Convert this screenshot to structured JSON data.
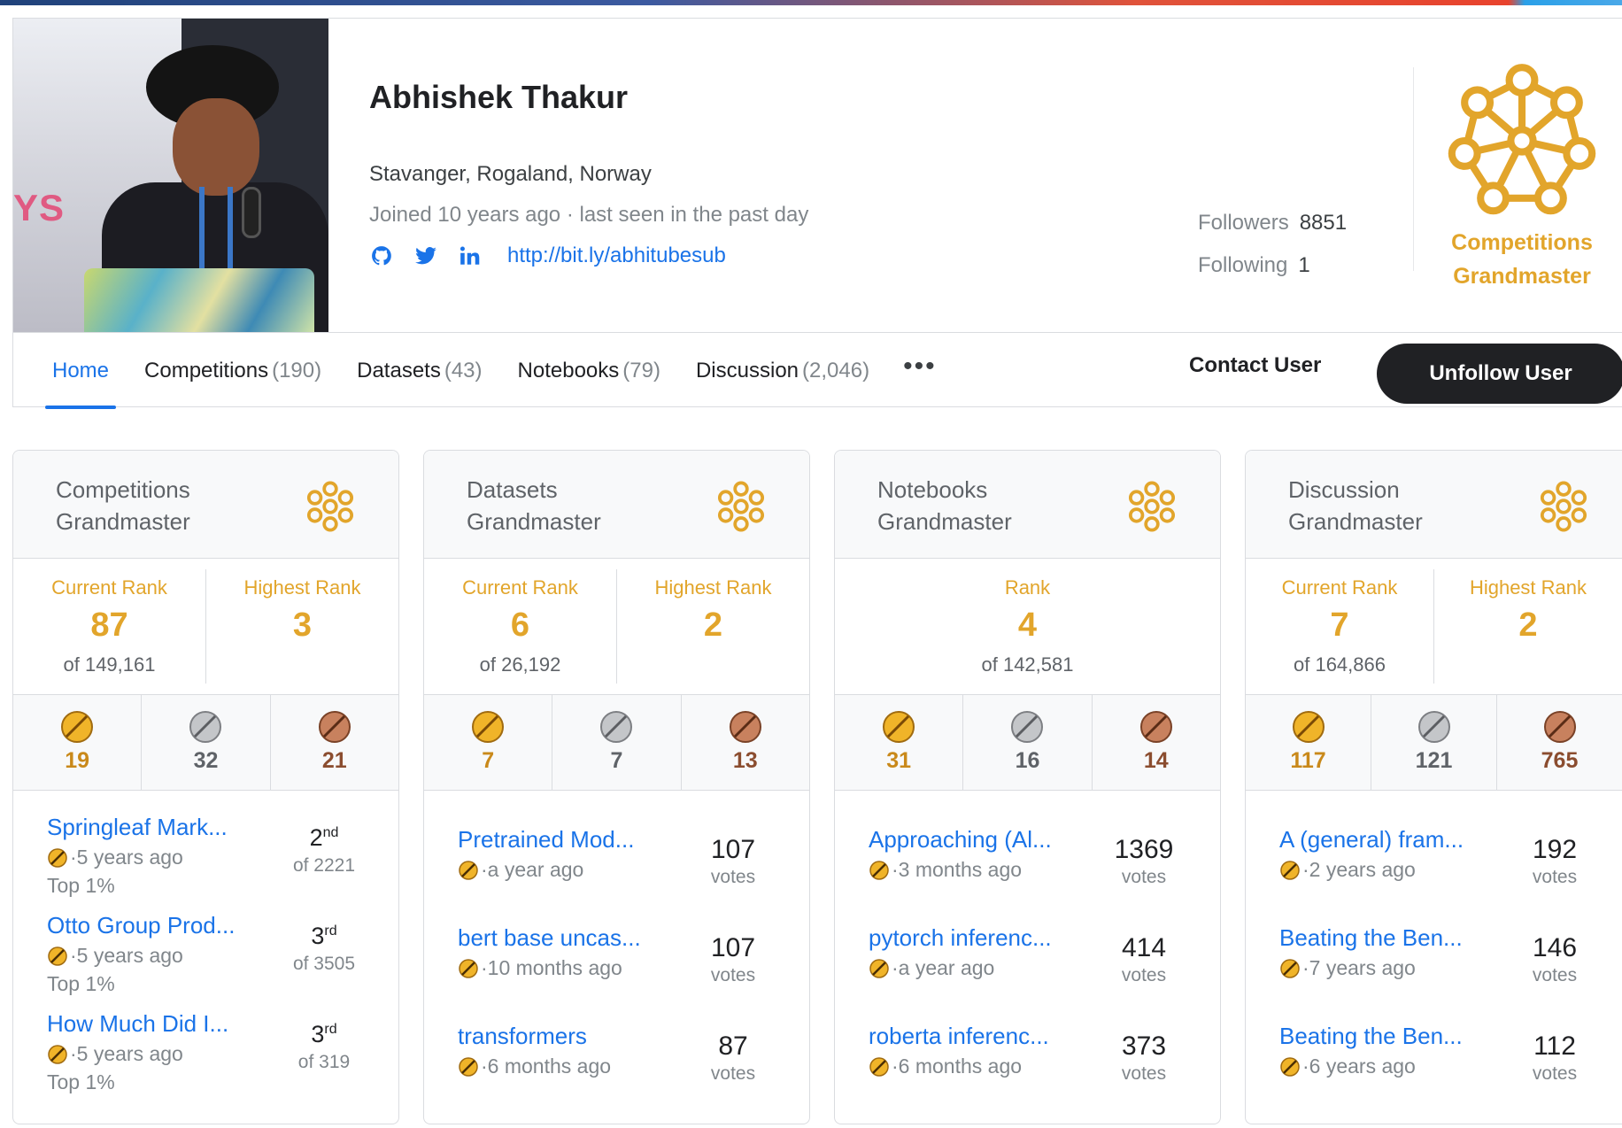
{
  "profile": {
    "name": "Abhishek Thakur",
    "location": "Stavanger, Rogaland, Norway",
    "joined": "Joined 10 years ago · last seen in the past day",
    "link": "http://bit.ly/abhitubesub",
    "followers_label": "Followers",
    "followers": "8851",
    "following_label": "Following",
    "following": "1",
    "tier_line1": "Competitions",
    "tier_line2": "Grandmaster",
    "tier_color": "#e2a52b"
  },
  "nav": {
    "tabs": [
      {
        "label": "Home",
        "count": ""
      },
      {
        "label": "Competitions",
        "count": "(190)"
      },
      {
        "label": "Datasets",
        "count": "(43)"
      },
      {
        "label": "Notebooks",
        "count": "(79)"
      },
      {
        "label": "Discussion",
        "count": "(2,046)"
      }
    ],
    "more": "•••",
    "contact": "Contact User",
    "unfollow": "Unfollow User"
  },
  "cards": [
    {
      "title1": "Competitions",
      "title2": "Grandmaster",
      "rank_label": "Current Rank",
      "rank": "87",
      "rank_of": "of 149,161",
      "high_label": "Highest Rank",
      "high": "3",
      "gold": "19",
      "silver": "32",
      "bronze": "21",
      "items": [
        {
          "title": "Springleaf Mark...",
          "age": "·5 years ago",
          "top": "Top 1%",
          "place": "2",
          "suffix": "nd",
          "of": "of 2221"
        },
        {
          "title": "Otto Group Prod...",
          "age": "·5 years ago",
          "top": "Top 1%",
          "place": "3",
          "suffix": "rd",
          "of": "of 3505"
        },
        {
          "title": "How Much Did I...",
          "age": "·5 years ago",
          "top": "Top 1%",
          "place": "3",
          "suffix": "rd",
          "of": "of 319"
        }
      ]
    },
    {
      "title1": "Datasets",
      "title2": "Grandmaster",
      "rank_label": "Current Rank",
      "rank": "6",
      "rank_of": "of 26,192",
      "high_label": "Highest Rank",
      "high": "2",
      "gold": "7",
      "silver": "7",
      "bronze": "13",
      "items": [
        {
          "title": "Pretrained Mod...",
          "age": "·a year ago",
          "votes": "107",
          "votes_label": "votes"
        },
        {
          "title": "bert base uncas...",
          "age": "·10 months ago",
          "votes": "107",
          "votes_label": "votes"
        },
        {
          "title": "transformers",
          "age": "·6 months ago",
          "votes": "87",
          "votes_label": "votes"
        }
      ]
    },
    {
      "title1": "Notebooks",
      "title2": "Grandmaster",
      "rank_label": "Rank",
      "rank": "4",
      "rank_of": "of 142,581",
      "gold": "31",
      "silver": "16",
      "bronze": "14",
      "items": [
        {
          "title": "Approaching (Al...",
          "age": "·3 months ago",
          "votes": "1369",
          "votes_label": "votes"
        },
        {
          "title": "pytorch inferenc...",
          "age": "·a year ago",
          "votes": "414",
          "votes_label": "votes"
        },
        {
          "title": "roberta inferenc...",
          "age": "·6 months ago",
          "votes": "373",
          "votes_label": "votes"
        }
      ]
    },
    {
      "title1": "Discussion",
      "title2": "Grandmaster",
      "rank_label": "Current Rank",
      "rank": "7",
      "rank_of": "of 164,866",
      "high_label": "Highest Rank",
      "high": "2",
      "gold": "117",
      "silver": "121",
      "bronze": "765",
      "items": [
        {
          "title": "A (general) fram...",
          "age": "·2 years ago",
          "votes": "192",
          "votes_label": "votes"
        },
        {
          "title": "Beating the Ben...",
          "age": "·7 years ago",
          "votes": "146",
          "votes_label": "votes"
        },
        {
          "title": "Beating the Ben...",
          "age": "·6 years ago",
          "votes": "112",
          "votes_label": "votes"
        }
      ]
    }
  ]
}
